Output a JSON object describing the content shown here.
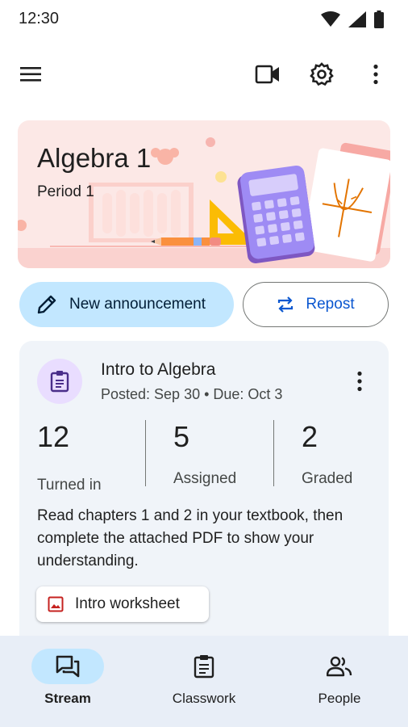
{
  "status_bar": {
    "time": "12:30"
  },
  "class": {
    "title": "Algebra 1",
    "section": "Period 1"
  },
  "actions": {
    "announce_label": "New announcement",
    "repost_label": "Repost"
  },
  "post": {
    "title": "Intro to Algebra",
    "meta": "Posted: Sep 30 • Due: Oct 3",
    "stats": [
      {
        "value": "12",
        "label": "Turned in"
      },
      {
        "value": "5",
        "label": "Assigned"
      },
      {
        "value": "2",
        "label": "Graded"
      }
    ],
    "description": "Read chapters 1 and 2 in your textbook, then complete the attached PDF to show your understanding.",
    "attachment": "Intro worksheet"
  },
  "nav": {
    "items": [
      {
        "label": "Stream",
        "icon": "stream-icon",
        "active": true
      },
      {
        "label": "Classwork",
        "icon": "classwork-icon",
        "active": false
      },
      {
        "label": "People",
        "icon": "people-icon",
        "active": false
      }
    ]
  },
  "colors": {
    "banner_bg": "#fce8e6",
    "announce_bg": "#c2e7ff",
    "accent": "#0b57d0",
    "card_bg": "#f0f4f9",
    "avatar_bg": "#e9ddff",
    "nav_bg": "#e8eef7"
  }
}
